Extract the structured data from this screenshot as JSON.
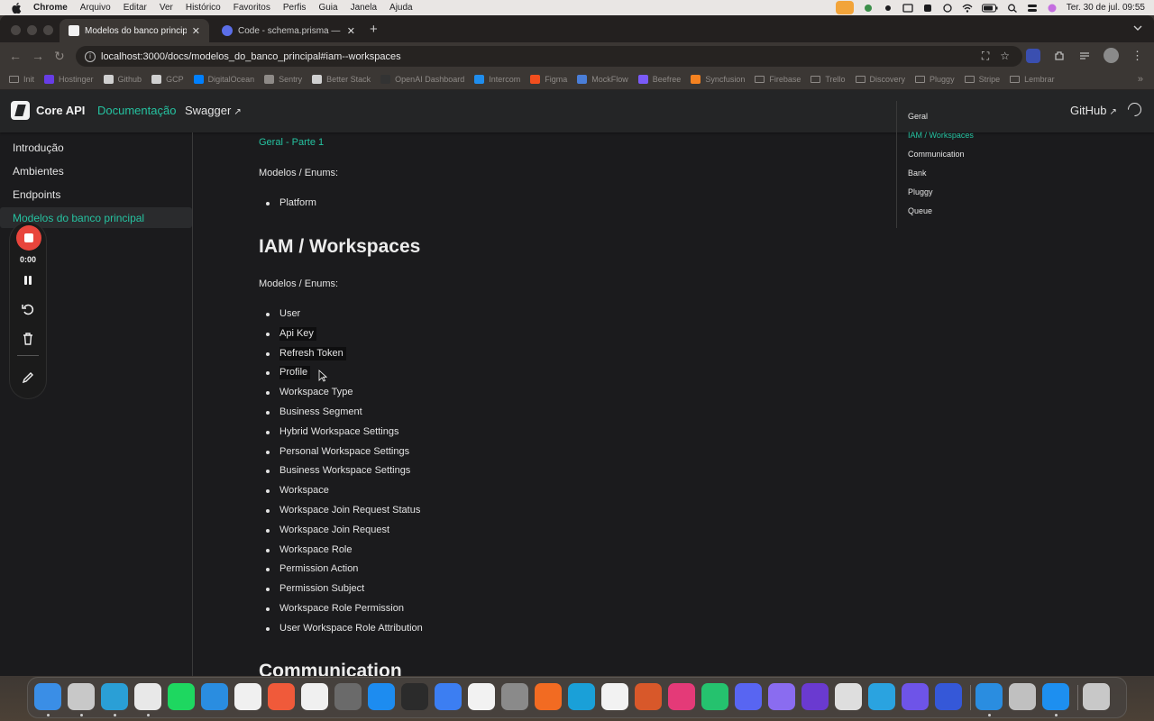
{
  "menubar": {
    "app": "Chrome",
    "items": [
      "Arquivo",
      "Editar",
      "Ver",
      "Histórico",
      "Favoritos",
      "Perfis",
      "Guia",
      "Janela",
      "Ajuda"
    ],
    "clock": "Ter. 30 de jul.  09:55"
  },
  "tabs": [
    {
      "title": "Modelos do banco principal |",
      "close": "✕"
    },
    {
      "title": "Code - schema.prisma — cor",
      "close": "✕"
    }
  ],
  "new_tab": "+",
  "address": {
    "url": "localhost:3000/docs/modelos_do_banco_principal#iam--workspaces"
  },
  "bookmarks": [
    {
      "label": "Init",
      "icon": "folder-icon"
    },
    {
      "label": "Hostinger",
      "icon": "hostinger-icon",
      "color": "#673de6"
    },
    {
      "label": "Github",
      "icon": "github-icon",
      "color": "#d0d0d0"
    },
    {
      "label": "GCP",
      "icon": "google-icon",
      "color": "#d0d0d0"
    },
    {
      "label": "DigitalOcean",
      "icon": "digitalocean-icon",
      "color": "#0080ff"
    },
    {
      "label": "Sentry",
      "icon": "sentry-icon",
      "color": "#8e8a87"
    },
    {
      "label": "Better Stack",
      "icon": "betterstack-icon",
      "color": "#d0d0d0"
    },
    {
      "label": "OpenAI Dashboard",
      "icon": "openai-icon",
      "color": "#333333"
    },
    {
      "label": "Intercom",
      "icon": "intercom-icon",
      "color": "#1f8ded"
    },
    {
      "label": "Figma",
      "icon": "figma-icon",
      "color": "#f24e1e"
    },
    {
      "label": "MockFlow",
      "icon": "mockflow-icon",
      "color": "#4a7ed8"
    },
    {
      "label": "Beefree",
      "icon": "beefree-icon",
      "color": "#7a5af8"
    },
    {
      "label": "Syncfusion",
      "icon": "syncfusion-icon",
      "color": "#f58220"
    },
    {
      "label": "Firebase",
      "icon": "folder-icon"
    },
    {
      "label": "Trello",
      "icon": "folder-icon"
    },
    {
      "label": "Discovery",
      "icon": "folder-icon"
    },
    {
      "label": "Pluggy",
      "icon": "folder-icon"
    },
    {
      "label": "Stripe",
      "icon": "folder-icon"
    },
    {
      "label": "Lembrar",
      "icon": "folder-icon"
    }
  ],
  "site": {
    "brand": "Core API",
    "nav": [
      {
        "label": "Documentação",
        "active": true
      },
      {
        "label": "Swagger",
        "external": "↗"
      }
    ],
    "github": "GitHub",
    "github_ext": "↗"
  },
  "sidebar": {
    "items": [
      {
        "label": "Introdução"
      },
      {
        "label": "Ambientes"
      },
      {
        "label": "Endpoints"
      },
      {
        "label": "Modelos do banco principal",
        "active": true
      }
    ]
  },
  "content": {
    "top_link": "Geral - Parte 1",
    "top_para": "Modelos / Enums:",
    "top_list": [
      "Platform"
    ],
    "heading": "IAM / Workspaces",
    "para": "Modelos / Enums:",
    "list": [
      "User",
      "Api Key",
      "Refresh Token",
      "Profile",
      "Workspace Type",
      "Business Segment",
      "Hybrid Workspace Settings",
      "Personal Workspace Settings",
      "Business Workspace Settings",
      "Workspace",
      "Workspace Join Request Status",
      "Workspace Join Request",
      "Workspace Role",
      "Permission Action",
      "Permission Subject",
      "Workspace Role Permission",
      "User Workspace Role Attribution"
    ],
    "next_heading": "Communication"
  },
  "toc": {
    "items": [
      {
        "label": "Geral"
      },
      {
        "label": "IAM / Workspaces",
        "active": true
      },
      {
        "label": "Communication"
      },
      {
        "label": "Bank"
      },
      {
        "label": "Pluggy"
      },
      {
        "label": "Queue"
      }
    ]
  },
  "recorder": {
    "time": "0:00"
  },
  "colors": {
    "accent": "#25c2a0",
    "record": "#e8453c"
  },
  "dock": {
    "apps": [
      {
        "name": "finder-icon",
        "color": "#3a8ee6"
      },
      {
        "name": "launchpad-icon",
        "color": "#c8c8c8"
      },
      {
        "name": "cursor-app-icon",
        "color": "#2a9fd6"
      },
      {
        "name": "chrome-icon",
        "color": "#e8e8e8"
      },
      {
        "name": "spotify-icon",
        "color": "#1ed760"
      },
      {
        "name": "vscode-icon",
        "color": "#2a8de0"
      },
      {
        "name": "word-icon",
        "color": "#f0f0f0"
      },
      {
        "name": "pencil-app-icon",
        "color": "#f05a3a"
      },
      {
        "name": "slack-icon",
        "color": "#f0f0f0"
      },
      {
        "name": "inkscape-icon",
        "color": "#6a6a6a"
      },
      {
        "name": "appstore-icon",
        "color": "#1d8cf0"
      },
      {
        "name": "activity-monitor-icon",
        "color": "#2b2b2b"
      },
      {
        "name": "xcode-icon",
        "color": "#3c7ef2"
      },
      {
        "name": "notion-icon",
        "color": "#f2f2f2"
      },
      {
        "name": "settings-icon",
        "color": "#8a8a8a"
      },
      {
        "name": "fusion360-icon",
        "color": "#f26b22"
      },
      {
        "name": "codeium-icon",
        "color": "#1aa0d8"
      },
      {
        "name": "mongodb-icon",
        "color": "#f2f2f2"
      },
      {
        "name": "matlab-icon",
        "color": "#d8582a"
      },
      {
        "name": "intellij-icon",
        "color": "#e43a78"
      },
      {
        "name": "datagrip-icon",
        "color": "#25c26e"
      },
      {
        "name": "discord-icon",
        "color": "#5865f2"
      },
      {
        "name": "figma-app-icon",
        "color": "#8a6cf0"
      },
      {
        "name": "orbit-icon",
        "color": "#6a3ad0"
      },
      {
        "name": "unity-icon",
        "color": "#dedede"
      },
      {
        "name": "telegram-icon",
        "color": "#2aa3e0"
      },
      {
        "name": "rewind-icon",
        "color": "#6e54e8"
      },
      {
        "name": "react-devtools-icon",
        "color": "#3558d8"
      },
      {
        "name": "vscode-icon-2",
        "color": "#2a8de0"
      },
      {
        "name": "preview-icon",
        "color": "#c0c0c0"
      },
      {
        "name": "docker-icon",
        "color": "#1d8ff0"
      },
      {
        "name": "trash-icon",
        "color": "#c8c8c8"
      }
    ]
  }
}
